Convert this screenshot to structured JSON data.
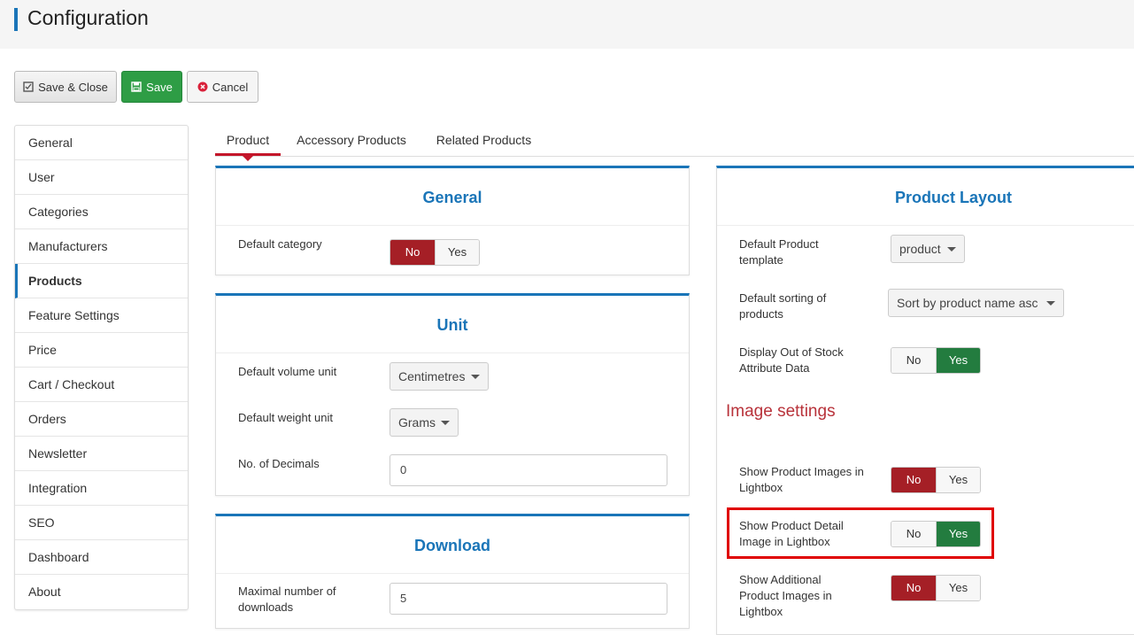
{
  "page": {
    "title": "Configuration"
  },
  "toolbar": {
    "save_close_label": "Save & Close",
    "save_label": "Save",
    "cancel_label": "Cancel"
  },
  "sidebar": {
    "items": [
      {
        "label": "General"
      },
      {
        "label": "User"
      },
      {
        "label": "Categories"
      },
      {
        "label": "Manufacturers"
      },
      {
        "label": "Products",
        "active": true
      },
      {
        "label": "Feature Settings"
      },
      {
        "label": "Price"
      },
      {
        "label": "Cart / Checkout"
      },
      {
        "label": "Orders"
      },
      {
        "label": "Newsletter"
      },
      {
        "label": "Integration"
      },
      {
        "label": "SEO"
      },
      {
        "label": "Dashboard"
      },
      {
        "label": "About"
      }
    ]
  },
  "tabs": [
    {
      "label": "Product",
      "active": true
    },
    {
      "label": "Accessory Products"
    },
    {
      "label": "Related Products"
    }
  ],
  "general_panel": {
    "title": "General",
    "default_category_label": "Default category",
    "default_category_value": "No"
  },
  "unit_panel": {
    "title": "Unit",
    "volume_label": "Default volume unit",
    "volume_value": "Centimetres",
    "weight_label": "Default weight unit",
    "weight_value": "Grams",
    "decimals_label": "No. of Decimals",
    "decimals_value": "0"
  },
  "download_panel": {
    "title": "Download",
    "max_downloads_label": "Maximal number of downloads",
    "max_downloads_value": "5"
  },
  "layout_panel": {
    "title": "Product Layout",
    "template_label": "Default Product template",
    "template_value": "product",
    "sorting_label": "Default sorting of products",
    "sorting_value": "Sort by product name asc",
    "out_of_stock_label": "Display Out of Stock Attribute Data",
    "out_of_stock_value": "Yes"
  },
  "image_settings": {
    "heading": "Image settings",
    "lightbox_label": "Show Product Images in Lightbox",
    "lightbox_value": "No",
    "detail_lightbox_label": "Show Product Detail Image in Lightbox",
    "detail_lightbox_value": "Yes",
    "additional_lightbox_label": "Show Additional Product Images in Lightbox",
    "additional_lightbox_value": "No"
  },
  "toggle_labels": {
    "no": "No",
    "yes": "Yes"
  },
  "colors": {
    "accent": "#1a75b8",
    "no_active": "#a51f26",
    "yes_active": "#237c3f",
    "save_button": "#2e9d45",
    "tab_active": "#c4162a",
    "highlight": "#e00000"
  }
}
